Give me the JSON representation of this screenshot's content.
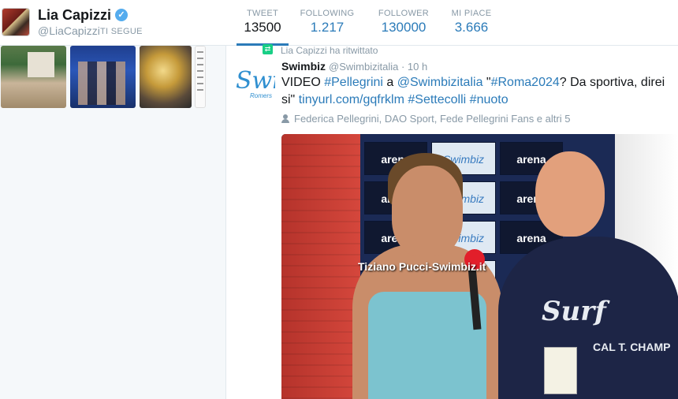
{
  "profile": {
    "name": "Lia Capizzi",
    "handle": "@LiaCapizzi",
    "follows_you": "TI SEGUE",
    "verified_glyph": "✓"
  },
  "stats": [
    {
      "label": "TWEET",
      "value": "13500",
      "active": true
    },
    {
      "label": "FOLLOWING",
      "value": "1.217",
      "active": false
    },
    {
      "label": "FOLLOWER",
      "value": "130000",
      "active": false
    },
    {
      "label": "MI PIACE",
      "value": "3.666",
      "active": false
    }
  ],
  "colors": {
    "link": "#2b7bb9",
    "muted": "#8899a6",
    "verified": "#55acee",
    "retweet": "#19cf86"
  },
  "tweet": {
    "retweeted_by": "Lia Capizzi ha ritwittato",
    "author_name": "Swimbiz",
    "author_handle": "@Swimbizitalia",
    "time": "10 h",
    "avatar_text": "Swi",
    "avatar_sub": "Romers",
    "body": {
      "p1": "VIDEO ",
      "tag1": "#Pellegrini",
      "p2": " a ",
      "mention": "@Swimbizitalia",
      "p3": " \"",
      "tag2": "#Roma2024",
      "p4": "? Da sportiva, direi si\" ",
      "url": "tinyurl.com/gqfrklm",
      "p5": " ",
      "tag3": "#Settecolli",
      "p6": " ",
      "tag4": "#nuoto"
    },
    "liked_by": "Federica Pellegrini, DAO Sport, Fede Pellegrini Fans e altri 5",
    "media": {
      "caption": "Tiziano Pucci-Swimbiz.it",
      "wall_brand_1": "arena",
      "wall_brand_2": "Swimbiz",
      "shirt_text": "Surf",
      "shirt_text2": "CAL T. CHAMP"
    }
  }
}
